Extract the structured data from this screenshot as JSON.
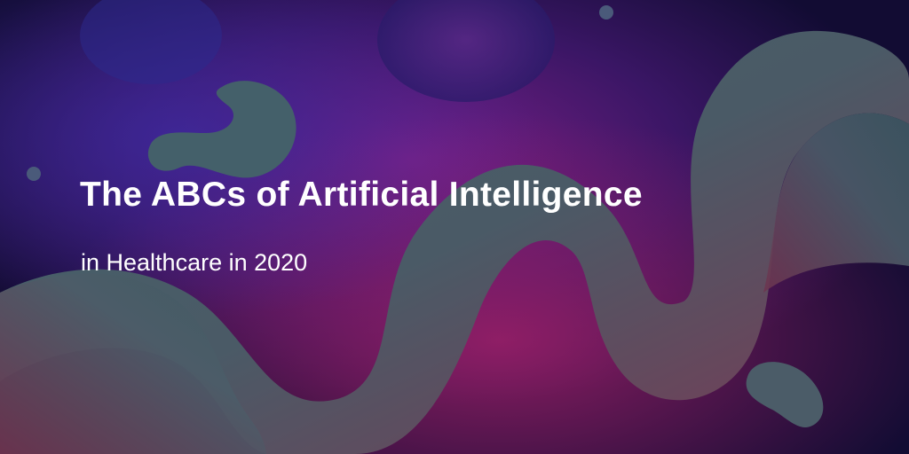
{
  "banner": {
    "title": "The ABCs of Artificial Intelligence",
    "subtitle": "in Healthcare in 2020"
  },
  "palette": {
    "background_dark": "#120c33",
    "background_purple": "#6a1a78",
    "background_magenta": "#8a2060",
    "ribbon_teal": "#3f5a63",
    "ribbon_rose": "#7a3a52",
    "text": "#ffffff"
  }
}
